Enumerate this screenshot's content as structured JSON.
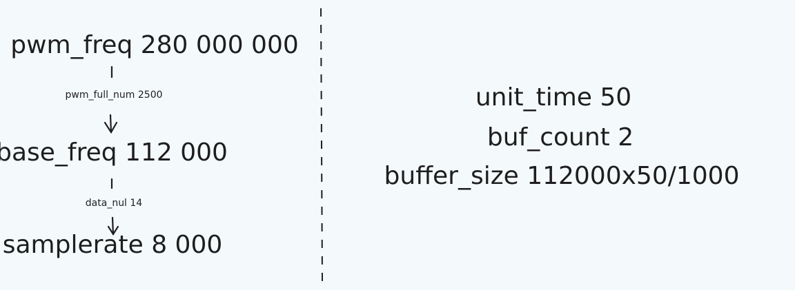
{
  "left_flow": {
    "pwm_freq": "pwm_freq 280 000 000",
    "pwm_full_num": "pwm_full_num 2500",
    "base_freq": "base_freq 112 000",
    "data_nul": "data_nul 14",
    "samplerate": "samplerate 8 000"
  },
  "right_panel": {
    "unit_time": "unit_time 50",
    "buf_count": "buf_count 2",
    "buffer_size": "buffer_size 112000x50/1000"
  }
}
